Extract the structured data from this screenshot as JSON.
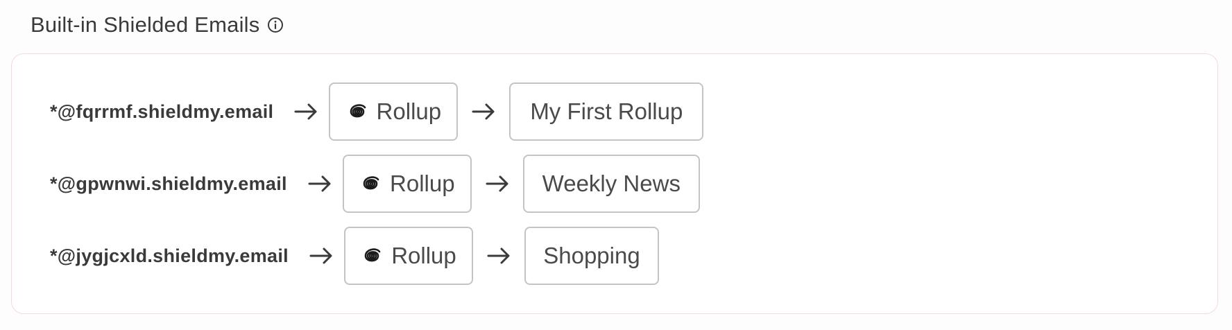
{
  "section": {
    "title": "Built-in Shielded Emails",
    "icon": "info-icon"
  },
  "rows": [
    {
      "email": "*@fqrrmf.shieldmy.email",
      "app": {
        "icon": "swirl-icon",
        "label": "Rollup"
      },
      "destination": "My First Rollup"
    },
    {
      "email": "*@gpwnwi.shieldmy.email",
      "app": {
        "icon": "swirl-icon",
        "label": "Rollup"
      },
      "destination": "Weekly News"
    },
    {
      "email": "*@jygjcxld.shieldmy.email",
      "app": {
        "icon": "swirl-icon",
        "label": "Rollup"
      },
      "destination": "Shopping"
    }
  ]
}
